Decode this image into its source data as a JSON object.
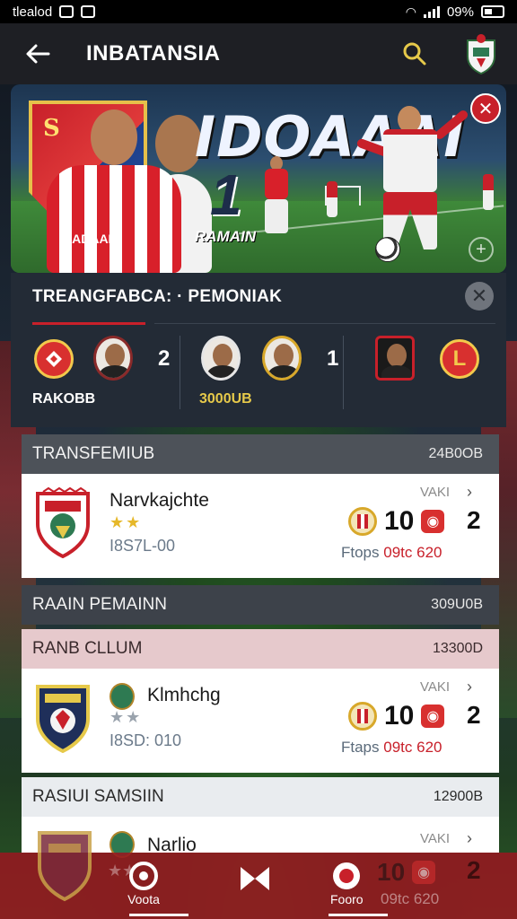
{
  "status_bar": {
    "left_text": "tlealod",
    "right_text": "09%"
  },
  "app_bar": {
    "title": "INBATANSIA"
  },
  "hero": {
    "big_title": "IDOAAAI",
    "number": "1",
    "badge_text": "S",
    "shirt_label": "DADAAN",
    "sub_text": "RAMAIN",
    "right_badge": "✕"
  },
  "featured": {
    "title": "TREANGFABCA: · PEMONIAK",
    "matches": [
      {
        "score": "2",
        "label": "RAKOBB",
        "label_color": "#ffffff"
      },
      {
        "score": "1",
        "label": "3000UB",
        "label_color": "#e6c94a"
      },
      {
        "score": "",
        "label": "",
        "label_color": "#ffffff"
      }
    ]
  },
  "sections": [
    {
      "header": "TRANSFEMIUB",
      "header_value": "24B0OB",
      "card": {
        "name": "Narvkajchte",
        "stars": "★★",
        "meta": "I8S7L-00",
        "label_top": "VAKI",
        "score": "10",
        "rank": "2",
        "footer_label": "Ftops",
        "footer_value": "09tc 620"
      }
    },
    {
      "header": "RAAIN PEMAINN",
      "header_value": "309U0B",
      "sub_header": "RANB CLLUM",
      "sub_header_value": "13300D",
      "card": {
        "name": "Klmhchg",
        "stars": "★★",
        "meta": "I8SD: 010",
        "label_top": "VAKI",
        "score": "10",
        "rank": "2",
        "footer_label": "Ftaps",
        "footer_value": "09tc 620"
      }
    },
    {
      "header": "RASIUI SAMSIIN",
      "header_value": "12900B",
      "card": {
        "name": "Narlio",
        "label_top": "VAKI",
        "score": "10",
        "rank": "2",
        "footer_value": "09tc 620"
      }
    }
  ],
  "bottom_nav": {
    "items": [
      {
        "label": "Voota",
        "icon": "target-icon"
      },
      {
        "label": "",
        "icon": "bowtie-icon"
      },
      {
        "label": "Fooro",
        "icon": "ball-icon"
      }
    ]
  },
  "colors": {
    "accent": "#c8202a",
    "gold": "#e6c94a",
    "panel": "#232b36"
  }
}
